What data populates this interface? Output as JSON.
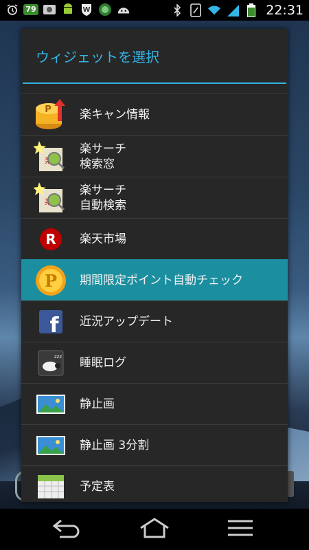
{
  "statusbar": {
    "battery_badge": "79",
    "battery_level": "79",
    "time": "22:31"
  },
  "dialog": {
    "title": "ウィジェットを選択",
    "items": [
      {
        "name": "rakucan",
        "lines": [
          "楽キャン情報"
        ],
        "icon": "rakuten-point-box-icon"
      },
      {
        "name": "rakusearch-box",
        "lines": [
          "楽サーチ",
          "検索窓"
        ],
        "icon": "rakusearch-icon"
      },
      {
        "name": "rakusearch-auto",
        "lines": [
          "楽サーチ",
          "自動検索"
        ],
        "icon": "rakusearch-icon"
      },
      {
        "name": "rakuten-ichiba",
        "lines": [
          "楽天市場"
        ],
        "icon": "rakuten-r-icon"
      },
      {
        "name": "point-check",
        "lines": [
          "期間限定ポイント自動チェック"
        ],
        "icon": "point-coin-icon",
        "selected": true
      },
      {
        "name": "facebook",
        "lines": [
          "近況アップデート"
        ],
        "icon": "facebook-icon"
      },
      {
        "name": "sleep-log",
        "lines": [
          "睡眠ログ"
        ],
        "icon": "sleep-sheep-icon"
      },
      {
        "name": "still-image",
        "lines": [
          "静止画"
        ],
        "icon": "picture-icon"
      },
      {
        "name": "still-image-3",
        "lines": [
          "静止画 3分割"
        ],
        "icon": "picture-icon"
      },
      {
        "name": "schedule",
        "lines": [
          "予定表"
        ],
        "icon": "calendar-icon"
      }
    ]
  },
  "colors": {
    "accent": "#33b5e5",
    "selected": "#1b8fa0",
    "dialog_bg": "#272727"
  }
}
